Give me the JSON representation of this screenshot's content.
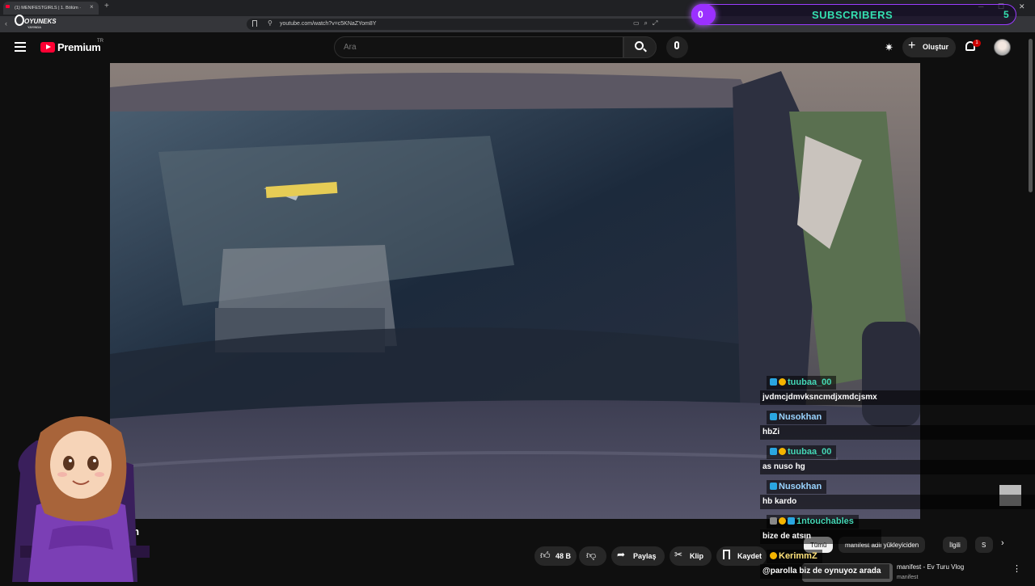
{
  "browser": {
    "tab_title": "(1) MENIFESTGIRLS | 1. Bölüm ·",
    "tab_close": "×",
    "new_tab": "+",
    "url": "youtube.com/watch?v=c5KNaZYom8Y",
    "window_controls": {
      "minimize": "─",
      "maximize": "☐",
      "close": "✕"
    }
  },
  "overlay": {
    "logo_text": "OYUNEKS",
    "logo_sub": "YAYINDA",
    "subscribers_label": "SUBSCRIBERS",
    "subscribers_current": "0",
    "subscribers_goal": "5"
  },
  "masthead": {
    "brand": "Premium",
    "country": "TR",
    "search_placeholder": "Ara",
    "create_label": "Oluştur",
    "notification_count": "1"
  },
  "video": {
    "title_fragment": "lüm",
    "actions": {
      "likes": "48 B",
      "share": "Paylaş",
      "clip": "Klip",
      "save": "Kaydet"
    }
  },
  "chips": [
    "Tümü",
    "manifest adlı yükleyiciden",
    "İlgili",
    "S"
  ],
  "recommendation": {
    "title": "manifest - Ev Turu Vlog",
    "channel": "manifest"
  },
  "chat": [
    {
      "user": "tuubaa_00",
      "message": "jvdmcjdmvksncmdjxmdcjsmx",
      "color": "#44d7b6"
    },
    {
      "user": "Nusokhan",
      "message": "hbZi",
      "color": "#9ad4ff"
    },
    {
      "user": "tuubaa_00",
      "message": "as nuso hg",
      "color": "#44d7b6"
    },
    {
      "user": "Nusokhan",
      "message": "hb kardo",
      "color": "#9ad4ff"
    },
    {
      "user": "1ntouchables",
      "message": "bize de atsın",
      "color": "#44d7b6"
    },
    {
      "user": "KerimmZ",
      "message": "@parolla biz de oynuyoz arada",
      "color": "#ffe27a"
    }
  ]
}
